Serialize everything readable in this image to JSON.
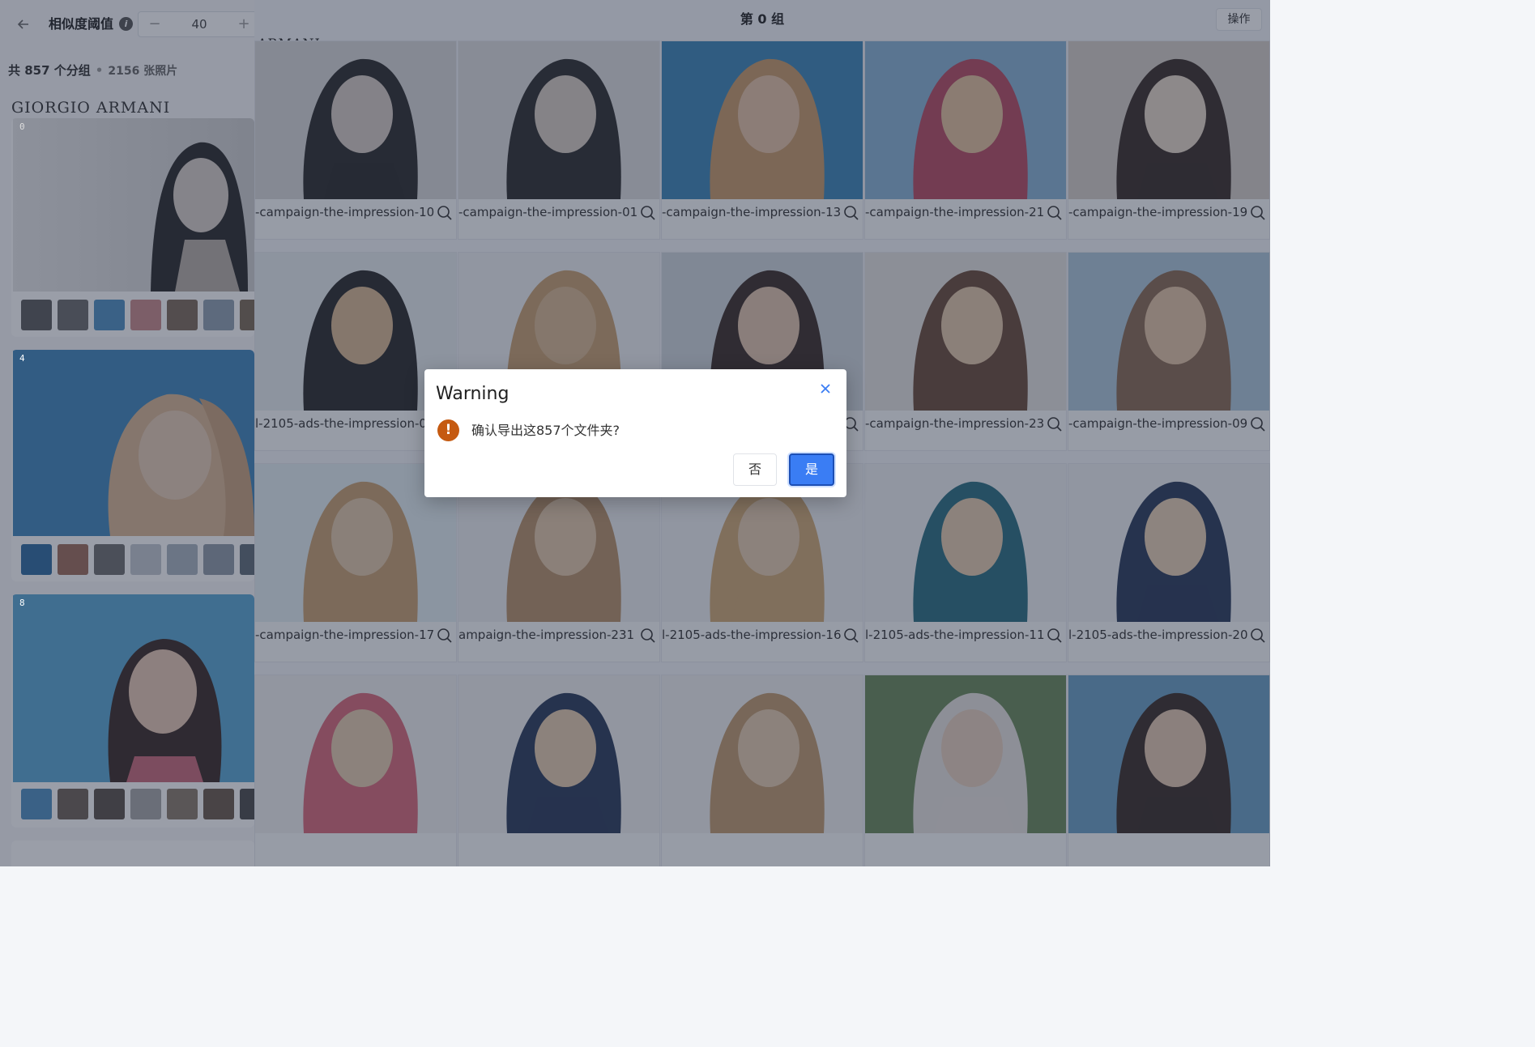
{
  "left_panel": {
    "threshold_label": "相似度阈值",
    "threshold_value": "40",
    "minus_symbol": "−",
    "plus_symbol": "+",
    "summary_groups": "共 857 个分组",
    "summary_dot": "•",
    "summary_photos": "2156 张照片",
    "brand_strip": "GIORGIO ARMANI",
    "groups": [
      {
        "index": "0"
      },
      {
        "index": "4"
      },
      {
        "index": "8"
      }
    ]
  },
  "right_panel": {
    "title": "第 0 组",
    "ops_button": "操作",
    "brand_top": "ARMANI",
    "cards": [
      {
        "caption": "-campaign-the-impression-10"
      },
      {
        "caption": "-campaign-the-impression-01"
      },
      {
        "caption": "-campaign-the-impression-13"
      },
      {
        "caption": "-campaign-the-impression-21"
      },
      {
        "caption": "-campaign-the-impression-19"
      },
      {
        "caption": "l-2105-ads-the-impression-0"
      },
      {
        "caption": ""
      },
      {
        "caption": ""
      },
      {
        "caption": "-campaign-the-impression-23"
      },
      {
        "caption": "-campaign-the-impression-09"
      },
      {
        "caption": "-campaign-the-impression-17"
      },
      {
        "caption": "ampaign-the-impression-231"
      },
      {
        "caption": "l-2105-ads-the-impression-16"
      },
      {
        "caption": "l-2105-ads-the-impression-11"
      },
      {
        "caption": "l-2105-ads-the-impression-20"
      },
      {
        "caption": ""
      },
      {
        "caption": ""
      },
      {
        "caption": ""
      },
      {
        "caption": ""
      },
      {
        "caption": ""
      }
    ]
  },
  "dialog": {
    "title": "Warning",
    "message": "确认导出这857个文件夹?",
    "no_label": "否",
    "yes_label": "是",
    "colors": {
      "primary": "#3a7df4",
      "warning": "#c55a11"
    }
  }
}
